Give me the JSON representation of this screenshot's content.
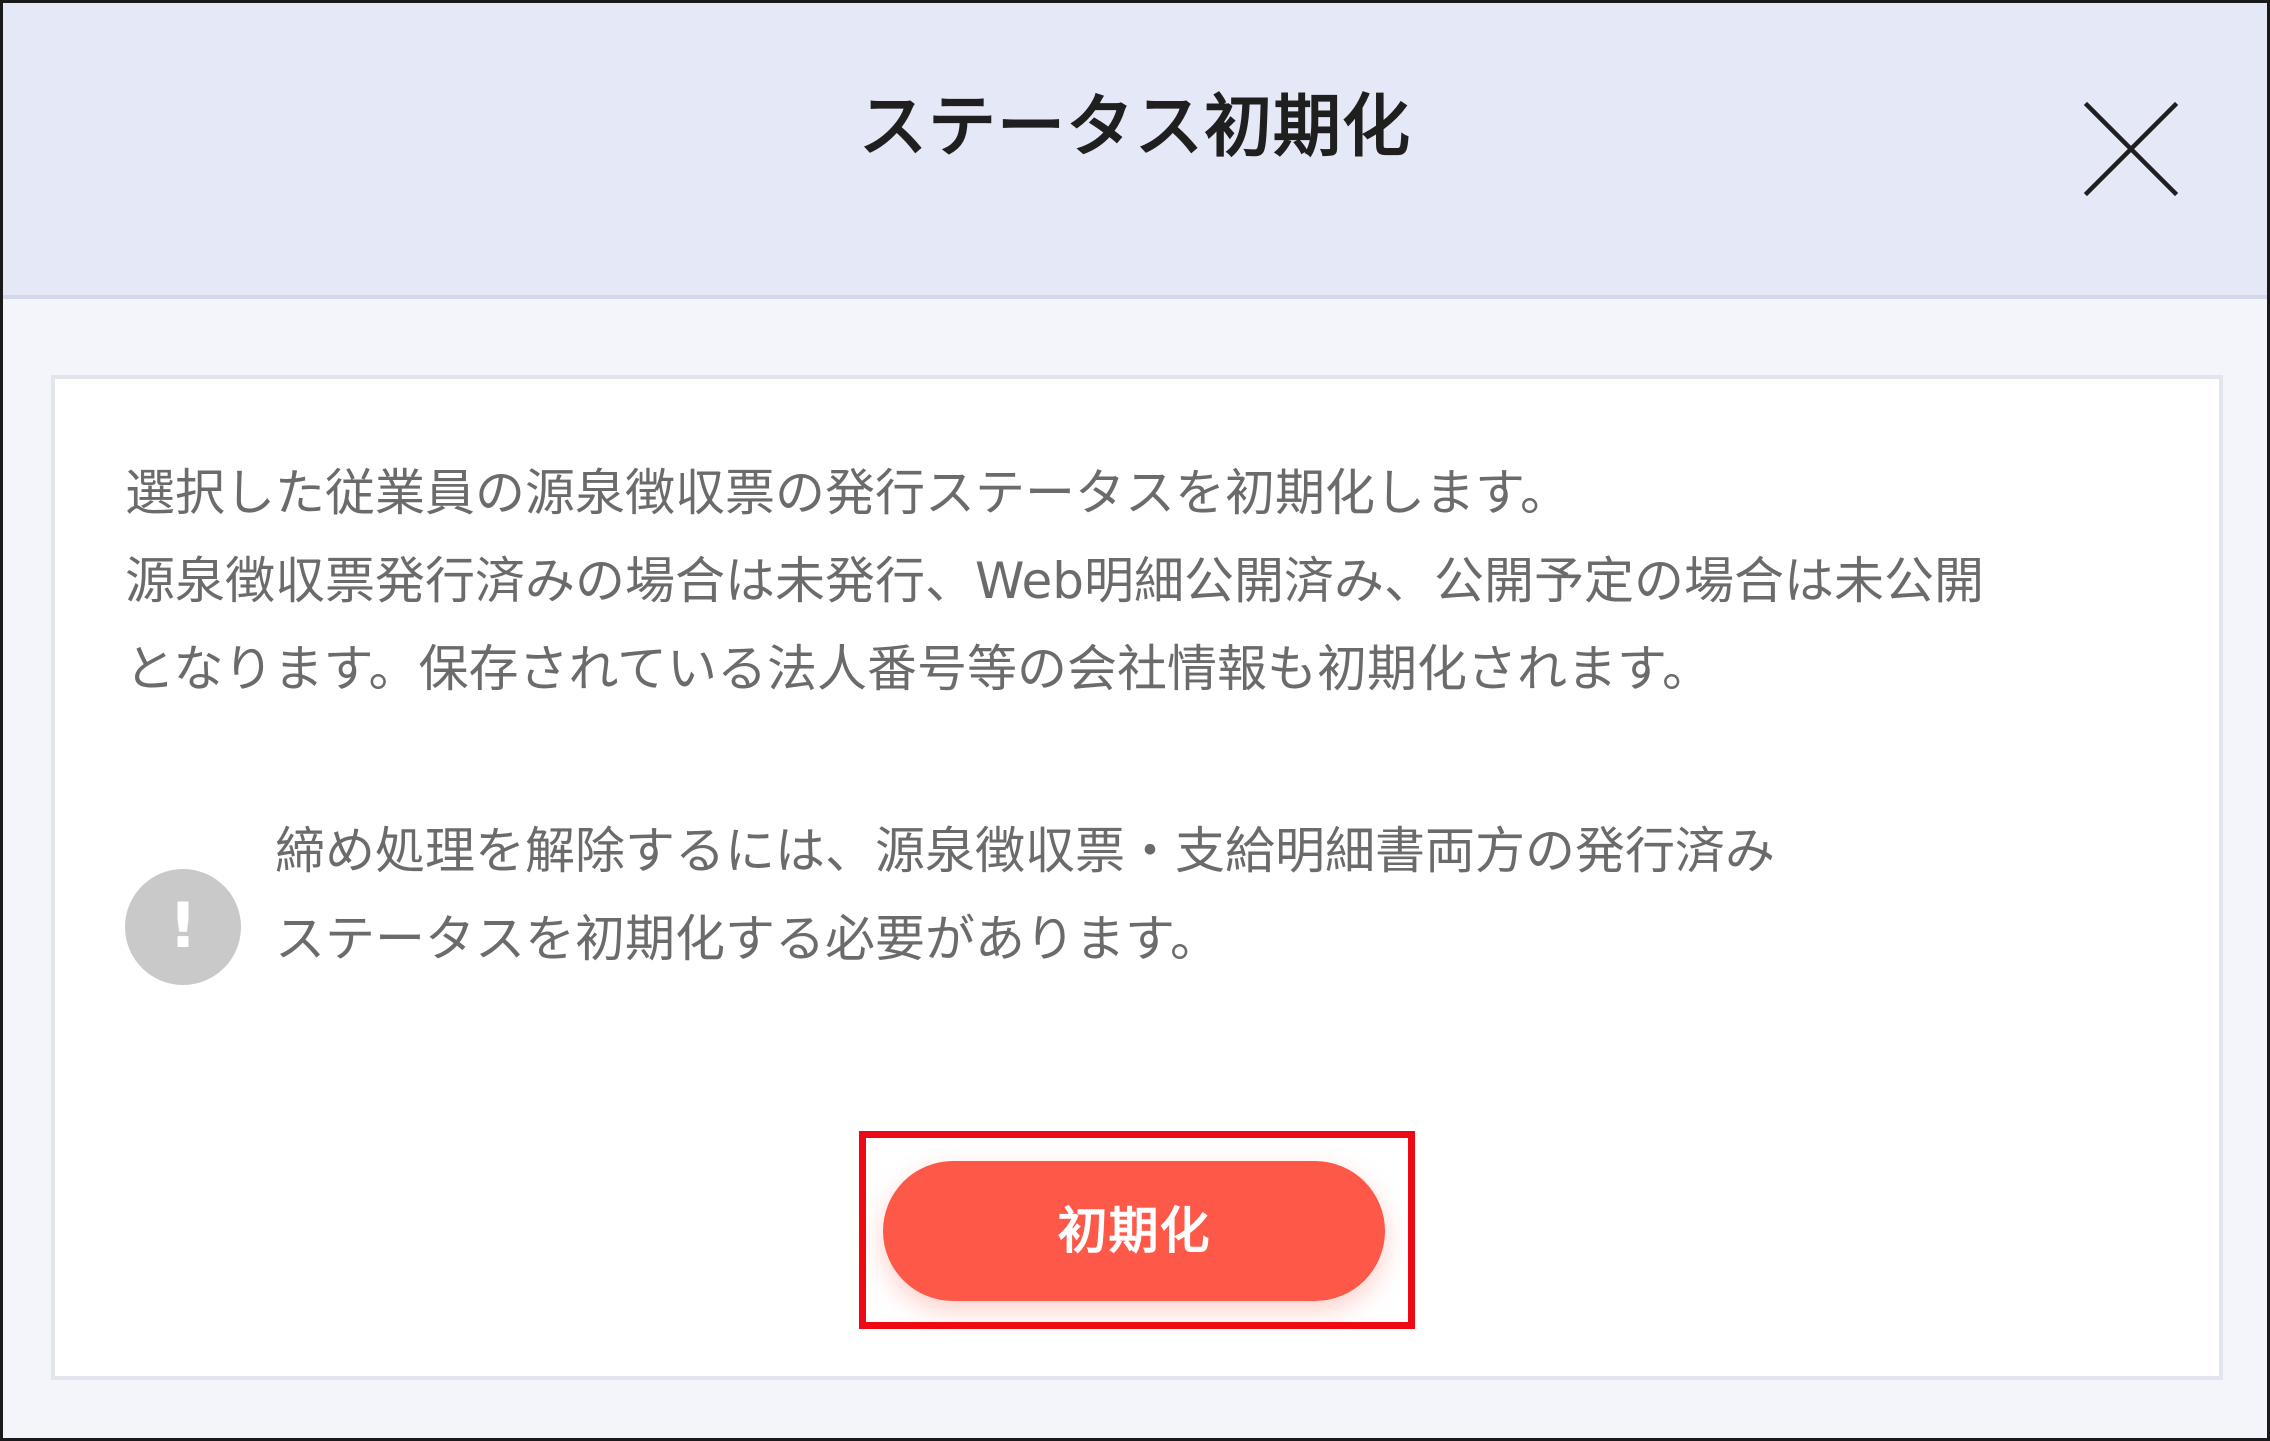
{
  "dialog": {
    "title": "ステータス初期化",
    "close_icon": "close-icon",
    "description_lines": [
      "選択した従業員の源泉徴収票の発行ステータスを初期化します。",
      "源泉徴収票発行済みの場合は未発行、Web明細公開済み、公開予定の場合は未公開",
      "となります。保存されている法人番号等の会社情報も初期化されます。"
    ],
    "notice": {
      "icon": "exclamation-icon",
      "glyph": "!",
      "lines": [
        "締め処理を解除するには、源泉徴収票・支給明細書両方の発行済み",
        "ステータスを初期化する必要があります。"
      ]
    },
    "primary_button_label": "初期化"
  },
  "colors": {
    "header_bg": "#e5e8f6",
    "body_bg": "#f4f5fa",
    "button_bg": "#fd5848",
    "highlight_border": "#ee0a14",
    "warning_icon_bg": "#c9c9c9",
    "text": "#6b6b6b"
  }
}
